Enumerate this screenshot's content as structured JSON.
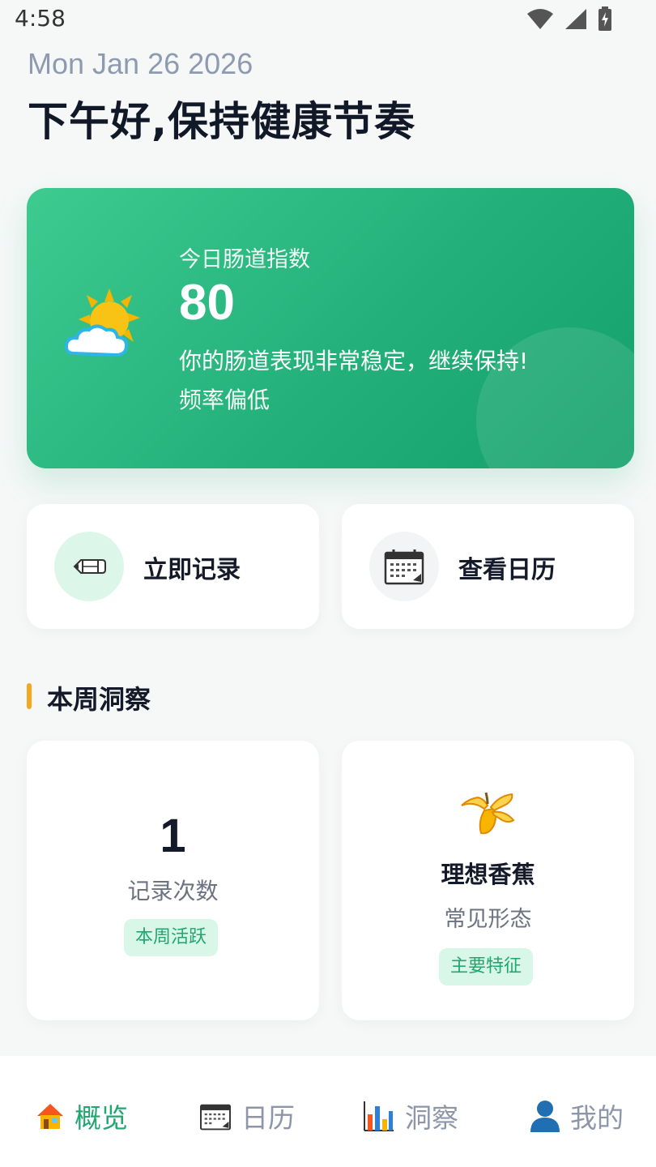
{
  "status_bar": {
    "time": "4:58"
  },
  "header": {
    "date": "Mon Jan 26 2026",
    "greeting": "下午好,保持健康节奏"
  },
  "hero": {
    "label": "今日肠道指数",
    "score": "80",
    "message": "你的肠道表现非常稳定，继续保持!",
    "note": "频率偏低",
    "icon": "sun-behind-cloud-icon"
  },
  "actions": [
    {
      "label": "立即记录",
      "icon": "pencil-icon"
    },
    {
      "label": "查看日历",
      "icon": "calendar-icon"
    }
  ],
  "insights": {
    "section_title": "本周洞察",
    "count_card": {
      "value": "1",
      "label": "记录次数",
      "tag": "本周活跃"
    },
    "shape_card": {
      "title": "理想香蕉",
      "subtitle": "常见形态",
      "tag": "主要特征",
      "icon": "banana-icon"
    }
  },
  "bottom_nav": [
    {
      "label": "概览",
      "icon": "house-icon",
      "active": true
    },
    {
      "label": "日历",
      "icon": "calendar-icon",
      "active": false
    },
    {
      "label": "洞察",
      "icon": "bar-chart-icon",
      "active": false
    },
    {
      "label": "我的",
      "icon": "person-icon",
      "active": false
    }
  ],
  "colors": {
    "accent": "#1ea76e",
    "hero_start": "#3dcb90",
    "hero_end": "#13a06a",
    "section_marker": "#f5a623",
    "tag_bg": "#d9f7e8"
  }
}
